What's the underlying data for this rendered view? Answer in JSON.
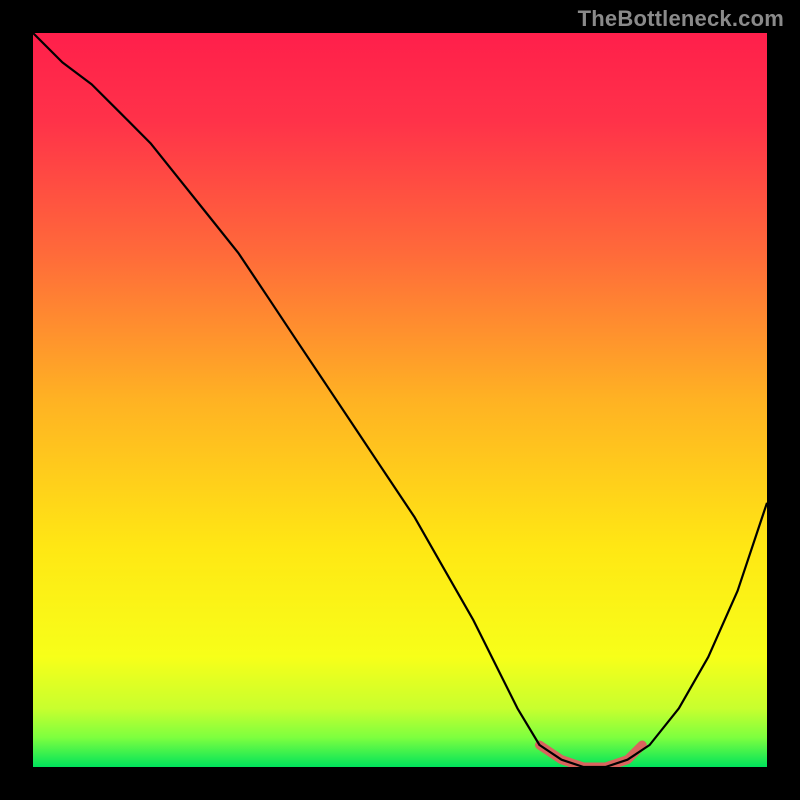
{
  "watermark": "TheBottleneck.com",
  "chart_data": {
    "type": "line",
    "title": "",
    "xlabel": "",
    "ylabel": "",
    "xlim": [
      0,
      100
    ],
    "ylim": [
      0,
      100
    ],
    "series": [
      {
        "name": "bottleneck-curve",
        "x": [
          0,
          4,
          8,
          12,
          16,
          20,
          24,
          28,
          32,
          36,
          40,
          44,
          48,
          52,
          56,
          60,
          63,
          66,
          69,
          72,
          75,
          78,
          81,
          84,
          88,
          92,
          96,
          100
        ],
        "values": [
          100,
          96,
          93,
          89,
          85,
          80,
          75,
          70,
          64,
          58,
          52,
          46,
          40,
          34,
          27,
          20,
          14,
          8,
          3,
          1,
          0,
          0,
          1,
          3,
          8,
          15,
          24,
          36
        ]
      },
      {
        "name": "flat-zone",
        "x": [
          69,
          72,
          75,
          78,
          81,
          83
        ],
        "values": [
          3,
          1,
          0,
          0,
          1,
          3
        ]
      }
    ],
    "gradient_stops": [
      {
        "pos": 0.0,
        "color": "#ff1f4b"
      },
      {
        "pos": 0.12,
        "color": "#ff3249"
      },
      {
        "pos": 0.3,
        "color": "#ff6a3a"
      },
      {
        "pos": 0.5,
        "color": "#ffb223"
      },
      {
        "pos": 0.7,
        "color": "#ffe714"
      },
      {
        "pos": 0.85,
        "color": "#f7ff19"
      },
      {
        "pos": 0.92,
        "color": "#c8ff2e"
      },
      {
        "pos": 0.96,
        "color": "#7dff3f"
      },
      {
        "pos": 1.0,
        "color": "#00e35b"
      }
    ],
    "flat_zone_color": "#d9645e"
  }
}
